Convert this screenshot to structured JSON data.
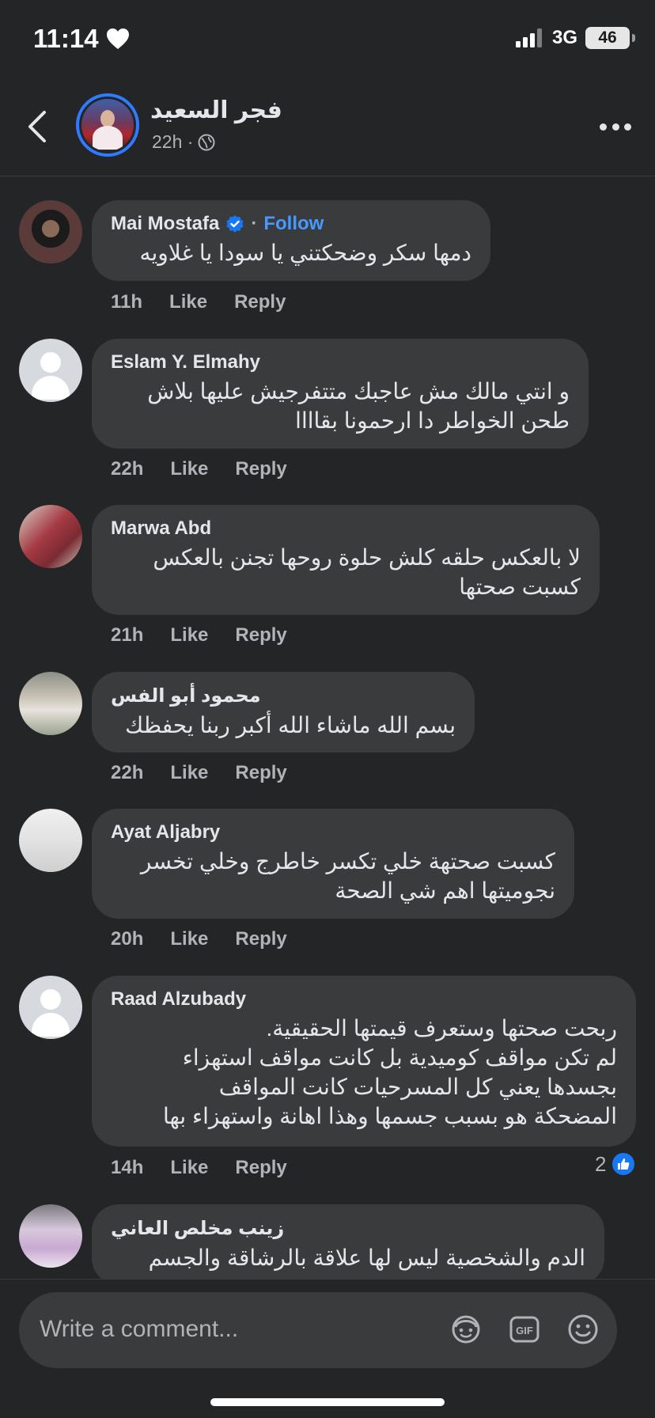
{
  "status_bar": {
    "time": "11:14",
    "network": "3G",
    "battery": "46"
  },
  "header": {
    "title": "فجر السعيد",
    "time": "22h ·"
  },
  "comments": [
    {
      "author": "Mai Mostafa",
      "verified": true,
      "separator": "·",
      "follow": "Follow",
      "text": [
        "دمها سكر وضحكتني يا سودا يا غلاويه"
      ],
      "time": "11h",
      "like": "Like",
      "reply": "Reply"
    },
    {
      "author": "Eslam Y. Elmahy",
      "text": [
        "و انتي مالك مش عاجبك متتفرجيش عليها بلاش",
        "طحن الخواطر دا ارحمونا بقاااا"
      ],
      "time": "22h",
      "like": "Like",
      "reply": "Reply"
    },
    {
      "author": "Marwa Abd",
      "text": [
        "لا بالعكس حلقه كلش حلوة روحها تجنن بالعكس",
        "كسبت صحتها"
      ],
      "time": "21h",
      "like": "Like",
      "reply": "Reply"
    },
    {
      "author": "محمود أبو الفس",
      "text": [
        "بسم الله ماشاء الله أكبر ربنا يحفظك"
      ],
      "time": "22h",
      "like": "Like",
      "reply": "Reply"
    },
    {
      "author": "Ayat Aljabry",
      "text": [
        "كسبت صحتهة خلي تكسر خاطرج وخلي تخسر",
        "نجوميتها اهم شي الصحة"
      ],
      "time": "20h",
      "like": "Like",
      "reply": "Reply"
    },
    {
      "author": "Raad Alzubady",
      "text": [
        "ربحت صحتها وستعرف قيمتها الحقيقية.",
        "لم تكن مواقف كوميدية بل كانت مواقف استهزاء",
        "بجسدها يعني كل المسرحيات كانت المواقف",
        "المضحكة هو بسبب جسمها وهذا اهانة واستهزاء بها"
      ],
      "time": "14h",
      "like": "Like",
      "reply": "Reply",
      "reaction_count": "2"
    },
    {
      "author": "زينب مخلص العاني",
      "text": [
        "الدم والشخصية ليس لها علاقة بالرشاقة والجسم"
      ]
    }
  ],
  "composer": {
    "placeholder": "Write a comment..."
  },
  "icons": {
    "heart": "heart-icon",
    "signal": "signal-icon",
    "back": "chevron-left-icon",
    "globe": "globe-icon",
    "more": "more-icon",
    "verified": "verified-icon",
    "avatar_sticker": "avatar-sticker-icon",
    "gif": "gif-icon",
    "emoji": "emoji-icon",
    "like": "thumbs-up-icon"
  },
  "colors": {
    "background": "#242527",
    "bubble": "#3a3b3d",
    "link": "#4599ff",
    "like_blue": "#1877f2",
    "muted": "#b0b3b8"
  }
}
